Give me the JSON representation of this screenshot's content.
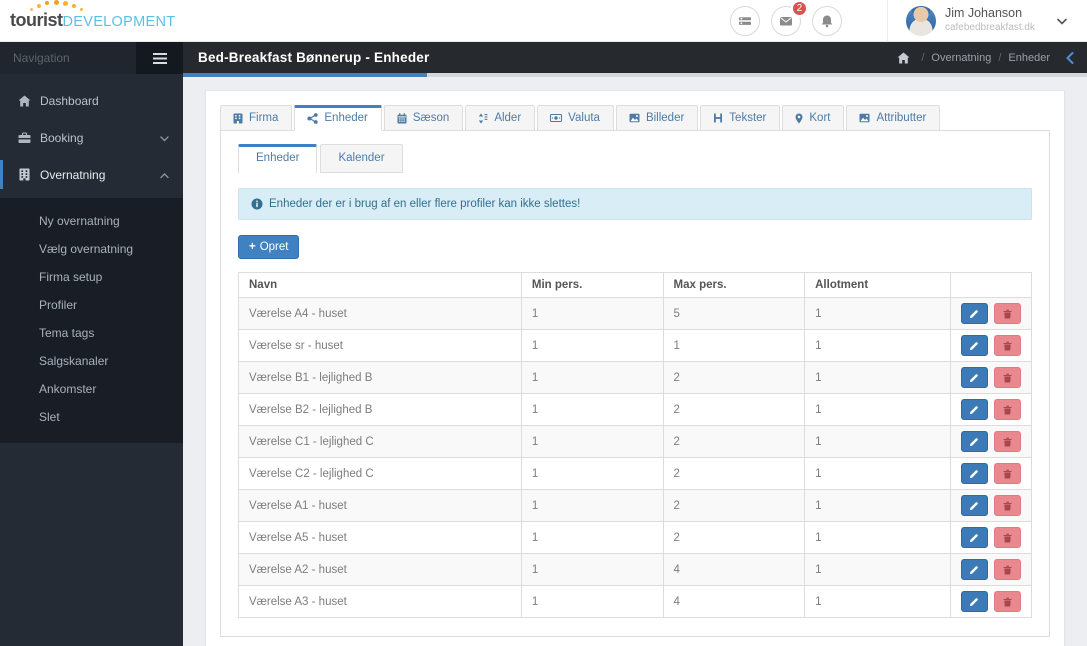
{
  "topbar": {
    "logo_primary": "tourist",
    "logo_secondary": "DEVELOPMENT",
    "unread_count": "2",
    "user_name": "Jim Johanson",
    "user_domain": "cafebedbreakfast.dk"
  },
  "icons": {
    "logo_sun": "arc-of-orange-dots",
    "messages": "list-icon",
    "mail": "envelope-icon",
    "alerts": "bell-icon",
    "edit": "pencil-icon",
    "delete": "trash-icon",
    "info": "info-circle-icon"
  },
  "sidebar": {
    "header": "Navigation",
    "items": [
      {
        "label": "Dashboard",
        "icon": "home-icon"
      },
      {
        "label": "Booking",
        "icon": "briefcase-icon",
        "caret": "down"
      },
      {
        "label": "Overnatning",
        "icon": "building-icon",
        "caret": "up",
        "active": true
      }
    ],
    "submenu": [
      "Ny overnatning",
      "Vælg overnatning",
      "Firma setup",
      "Profiler",
      "Tema tags",
      "Salgskanaler",
      "Ankomster",
      "Slet"
    ]
  },
  "header": {
    "title": "Bed-Breakfast Bønnerup - Enheder",
    "breadcrumb": [
      "Overnatning",
      "Enheder"
    ]
  },
  "tabs": [
    {
      "label": "Firma",
      "icon": "building-icon"
    },
    {
      "label": "Enheder",
      "icon": "share-nodes-icon",
      "active": true
    },
    {
      "label": "Sæson",
      "icon": "calendar-icon"
    },
    {
      "label": "Alder",
      "icon": "sort-icon"
    },
    {
      "label": "Valuta",
      "icon": "money-icon"
    },
    {
      "label": "Billeder",
      "icon": "image-icon"
    },
    {
      "label": "Tekster",
      "icon": "header-icon"
    },
    {
      "label": "Kort",
      "icon": "map-marker-icon"
    },
    {
      "label": "Attributter",
      "icon": "image-icon"
    }
  ],
  "subtabs": [
    {
      "label": "Enheder",
      "active": true
    },
    {
      "label": "Kalender"
    }
  ],
  "alert": {
    "text": "Enheder der er i brug af en eller flere profiler kan ikke slettes!"
  },
  "create_button": {
    "plus": "+",
    "label": "Opret"
  },
  "table": {
    "columns": [
      "Navn",
      "Min pers.",
      "Max pers.",
      "Allotment",
      ""
    ],
    "rows": [
      {
        "navn": "Værelse A4 - huset",
        "min": "1",
        "max": "5",
        "allotment": "1"
      },
      {
        "navn": "Værelse sr - huset",
        "min": "1",
        "max": "1",
        "allotment": "1"
      },
      {
        "navn": "Værelse B1 - lejlighed B",
        "min": "1",
        "max": "2",
        "allotment": "1"
      },
      {
        "navn": "Værelse B2 - lejlighed B",
        "min": "1",
        "max": "2",
        "allotment": "1"
      },
      {
        "navn": "Værelse C1 - lejlighed C",
        "min": "1",
        "max": "2",
        "allotment": "1"
      },
      {
        "navn": "Værelse C2 - lejlighed C",
        "min": "1",
        "max": "2",
        "allotment": "1"
      },
      {
        "navn": "Værelse A1 - huset",
        "min": "1",
        "max": "2",
        "allotment": "1"
      },
      {
        "navn": "Værelse A5 - huset",
        "min": "1",
        "max": "2",
        "allotment": "1"
      },
      {
        "navn": "Værelse A2 - huset",
        "min": "1",
        "max": "4",
        "allotment": "1"
      },
      {
        "navn": "Værelse A3 - huset",
        "min": "1",
        "max": "4",
        "allotment": "1"
      }
    ]
  },
  "colors": {
    "accent_blue": "#3f81c1",
    "sidebar_bg": "#252b35",
    "header_bg": "#26292e",
    "alert_bg": "#d9edf7",
    "delete_red": "#e9898f",
    "badge_red": "#d9534f",
    "logo_blue": "#5bc0e8",
    "sun_orange": "#f5a01e"
  }
}
